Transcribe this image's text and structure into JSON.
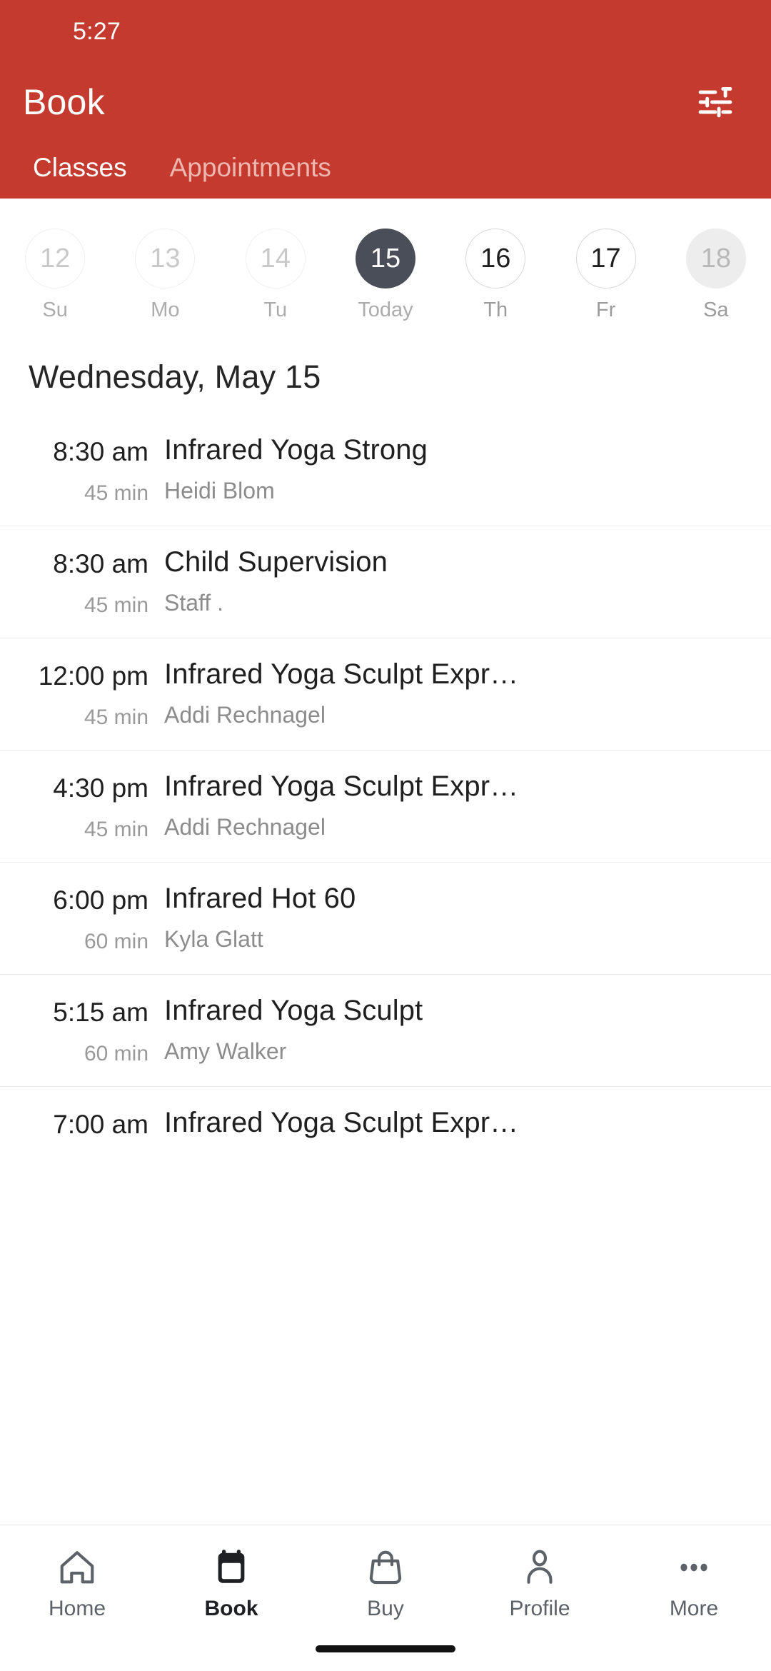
{
  "status_bar": {
    "time": "5:27"
  },
  "header": {
    "title": "Book",
    "background_color": "#C43A2E",
    "filter_icon": "tune-sliders-icon",
    "tabs": [
      {
        "label": "Classes",
        "active": true
      },
      {
        "label": "Appointments",
        "active": false
      }
    ]
  },
  "date_strip": {
    "days": [
      {
        "date": "12",
        "weekday": "Su",
        "state": "past"
      },
      {
        "date": "13",
        "weekday": "Mo",
        "state": "past"
      },
      {
        "date": "14",
        "weekday": "Tu",
        "state": "past"
      },
      {
        "date": "15",
        "weekday": "Today",
        "state": "selected"
      },
      {
        "date": "16",
        "weekday": "Th",
        "state": "normal"
      },
      {
        "date": "17",
        "weekday": "Fr",
        "state": "normal"
      },
      {
        "date": "18",
        "weekday": "Sa",
        "state": "shaded"
      }
    ],
    "selected_color": "#4A4E58"
  },
  "schedule": {
    "date_heading": "Wednesday, May 15",
    "classes": [
      {
        "time": "8:30 am",
        "duration": "45 min",
        "name": "Infrared Yoga Strong",
        "teacher": "Heidi Blom"
      },
      {
        "time": "8:30 am",
        "duration": "45 min",
        "name": "Child Supervision",
        "teacher": "Staff ."
      },
      {
        "time": "12:00 pm",
        "duration": "45 min",
        "name": "Infrared Yoga Sculpt Expr…",
        "teacher": "Addi Rechnagel"
      },
      {
        "time": "4:30 pm",
        "duration": "45 min",
        "name": "Infrared Yoga Sculpt Expr…",
        "teacher": "Addi Rechnagel"
      },
      {
        "time": "6:00 pm",
        "duration": "60 min",
        "name": "Infrared Hot 60",
        "teacher": "Kyla Glatt"
      },
      {
        "time": "5:15 am",
        "duration": "60 min",
        "name": "Infrared Yoga Sculpt",
        "teacher": "Amy Walker"
      },
      {
        "time": "7:00 am",
        "duration": "",
        "name": "Infrared Yoga Sculpt Expr…",
        "teacher": ""
      }
    ]
  },
  "bottom_nav": {
    "items": [
      {
        "label": "Home",
        "icon": "home-icon",
        "active": false
      },
      {
        "label": "Book",
        "icon": "calendar-icon",
        "active": true
      },
      {
        "label": "Buy",
        "icon": "shopping-bag-icon",
        "active": false
      },
      {
        "label": "Profile",
        "icon": "person-icon",
        "active": false
      },
      {
        "label": "More",
        "icon": "ellipsis-icon",
        "active": false
      }
    ]
  }
}
